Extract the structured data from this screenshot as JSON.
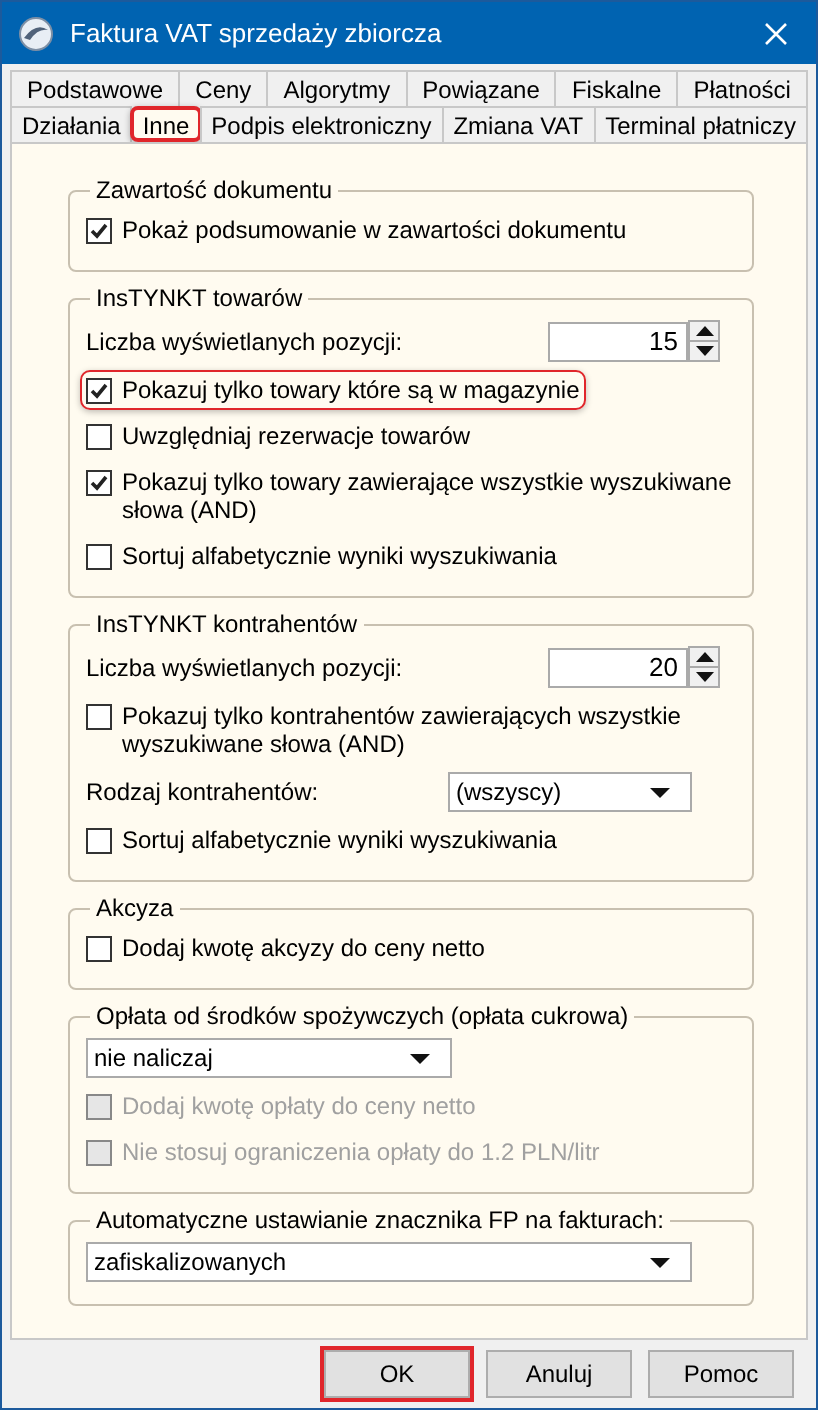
{
  "window": {
    "title": "Faktura VAT sprzedaży zbiorcza"
  },
  "tabs": [
    [
      {
        "label": "Podstawowe",
        "selected": false,
        "highlighted": false
      },
      {
        "label": "Ceny",
        "selected": false,
        "highlighted": false
      },
      {
        "label": "Algorytmy",
        "selected": false,
        "highlighted": false
      },
      {
        "label": "Powiązane",
        "selected": false,
        "highlighted": false
      },
      {
        "label": "Fiskalne",
        "selected": false,
        "highlighted": false
      },
      {
        "label": "Płatności",
        "selected": false,
        "highlighted": false
      }
    ],
    [
      {
        "label": "Działania",
        "selected": false,
        "highlighted": false
      },
      {
        "label": "Inne",
        "selected": true,
        "highlighted": true
      },
      {
        "label": "Podpis elektroniczny",
        "selected": false,
        "highlighted": false
      },
      {
        "label": "Zmiana VAT",
        "selected": false,
        "highlighted": false
      },
      {
        "label": "Terminal płatniczy",
        "selected": false,
        "highlighted": false
      }
    ]
  ],
  "groups": [
    {
      "title": "Zawartość dokumentu",
      "items": [
        {
          "kind": "checkbox",
          "label": "Pokaż podsumowanie w zawartości dokumentu",
          "checked": true,
          "disabled": false,
          "highlighted": false
        }
      ]
    },
    {
      "title": "InsTYNKT towarów",
      "items": [
        {
          "kind": "spinner",
          "label": "Liczba wyświetlanych pozycji:",
          "value": "15"
        },
        {
          "kind": "checkbox",
          "label": "Pokazuj tylko towary które są w magazynie",
          "checked": true,
          "disabled": false,
          "highlighted": true
        },
        {
          "kind": "checkbox",
          "label": "Uwzględniaj rezerwacje towarów",
          "checked": false,
          "disabled": false,
          "highlighted": false
        },
        {
          "kind": "checkbox",
          "label": "Pokazuj tylko towary zawierające wszystkie wyszukiwane słowa (AND)",
          "checked": true,
          "disabled": false,
          "highlighted": false
        },
        {
          "kind": "checkbox",
          "label": "Sortuj alfabetycznie wyniki wyszukiwania",
          "checked": false,
          "disabled": false,
          "highlighted": false
        }
      ]
    },
    {
      "title": "InsTYNKT kontrahentów",
      "items": [
        {
          "kind": "spinner",
          "label": "Liczba wyświetlanych pozycji:",
          "value": "20"
        },
        {
          "kind": "checkbox",
          "label": "Pokazuj tylko kontrahentów zawierających wszystkie wyszukiwane słowa (AND)",
          "checked": false,
          "disabled": false,
          "highlighted": false
        },
        {
          "kind": "select",
          "label": "Rodzaj kontrahentów:",
          "value": "(wszyscy)"
        },
        {
          "kind": "checkbox",
          "label": "Sortuj alfabetycznie wyniki wyszukiwania",
          "checked": false,
          "disabled": false,
          "highlighted": false
        }
      ]
    },
    {
      "title": "Akcyza",
      "items": [
        {
          "kind": "checkbox",
          "label": "Dodaj kwotę akcyzy do ceny netto",
          "checked": false,
          "disabled": false,
          "highlighted": false
        }
      ]
    },
    {
      "title": "Opłata od środków spożywczych (opłata cukrowa)",
      "items": [
        {
          "kind": "select",
          "value": "nie naliczaj"
        },
        {
          "kind": "checkbox",
          "label": "Dodaj kwotę opłaty do ceny netto",
          "checked": false,
          "disabled": true,
          "highlighted": false
        },
        {
          "kind": "checkbox",
          "label": "Nie stosuj ograniczenia opłaty do 1.2 PLN/litr",
          "checked": false,
          "disabled": true,
          "highlighted": false
        }
      ]
    },
    {
      "title": "Automatyczne ustawianie znacznika FP na fakturach:",
      "items": [
        {
          "kind": "select",
          "value": "zafiskalizowanych"
        }
      ]
    }
  ],
  "buttons": [
    {
      "label": "OK",
      "highlighted": true
    },
    {
      "label": "Anuluj",
      "highlighted": false
    },
    {
      "label": "Pomoc",
      "highlighted": false
    }
  ]
}
